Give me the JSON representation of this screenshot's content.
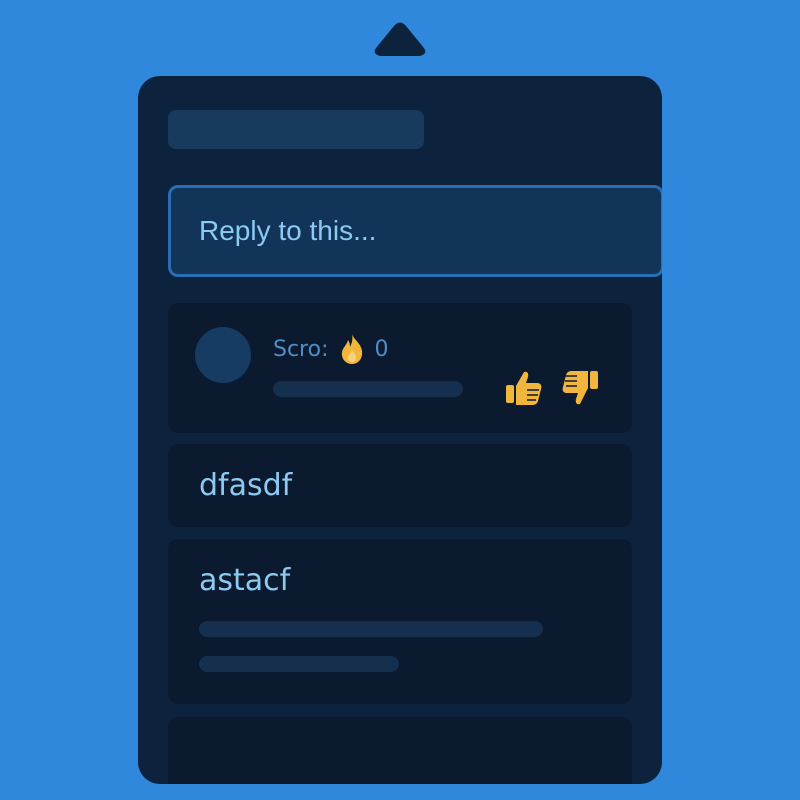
{
  "window": {
    "colors": {
      "background": "#2f88dc",
      "panel": "#0d223c",
      "card": "#0b1a2e",
      "text": "#8ccaf2",
      "accent": "#f2b63c"
    }
  },
  "reply": {
    "placeholder": "Reply to this..."
  },
  "post": {
    "score_label": "Scro:",
    "score_icon": "flame-icon",
    "score_value": "0",
    "upvote_icon": "thumbs-up-icon",
    "downvote_icon": "thumbs-down-icon"
  },
  "comments": [
    {
      "text": "dfasdf"
    },
    {
      "text": "astacf"
    }
  ]
}
